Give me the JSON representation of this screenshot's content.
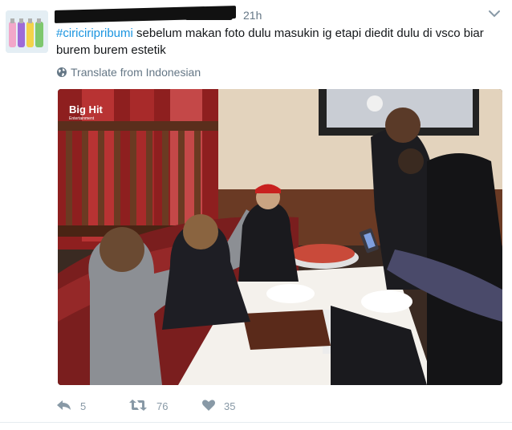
{
  "tweet": {
    "time": "21h",
    "hashtag": "#ciriciripribumi",
    "body": " sebelum makan foto dulu masukin ig etapi diedit dulu di vsco biar burem burem estetik",
    "translate_label": "Translate from Indonesian",
    "watermark": "Big Hit",
    "watermark_sub": "Entertainment"
  },
  "actions": {
    "reply_count": "5",
    "retweet_count": "76",
    "like_count": "35"
  },
  "colors": {
    "hashtag": "#1b95e0",
    "meta": "#657786",
    "action": "#8899a6"
  },
  "icons": [
    "globe-icon",
    "reply-icon",
    "retweet-icon",
    "heart-icon",
    "caret-down-icon"
  ]
}
